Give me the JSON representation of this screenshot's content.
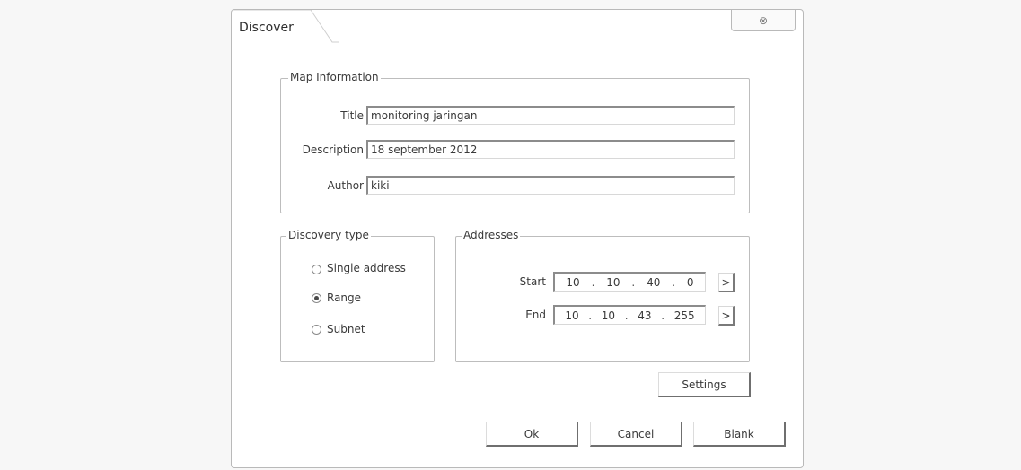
{
  "window": {
    "title": "Discover",
    "close_glyph": "⊗"
  },
  "map_info": {
    "legend": "Map Information",
    "title_label": "Title",
    "title_value": "monitoring jaringan",
    "description_label": "Description",
    "description_value": "18 september 2012",
    "author_label": "Author",
    "author_value": "kiki"
  },
  "discovery_type": {
    "legend": "Discovery type",
    "options": [
      "Single address",
      "Range",
      "Subnet"
    ],
    "selected": "Range"
  },
  "addresses": {
    "legend": "Addresses",
    "start_label": "Start",
    "start": [
      "10",
      "10",
      "40",
      "0"
    ],
    "end_label": "End",
    "end": [
      "10",
      "10",
      "43",
      "255"
    ],
    "arrow_glyph": ">"
  },
  "buttons": {
    "settings": "Settings",
    "ok": "Ok",
    "cancel": "Cancel",
    "blank": "Blank"
  },
  "icons": {
    "close": "close-icon",
    "arrow": "chevron-right-icon",
    "radio": "radio-icon"
  },
  "colors": {
    "background": "#f7f7f7",
    "dialog": "#ffffff",
    "border": "#b9b9b9",
    "text": "#3a3a3a"
  }
}
